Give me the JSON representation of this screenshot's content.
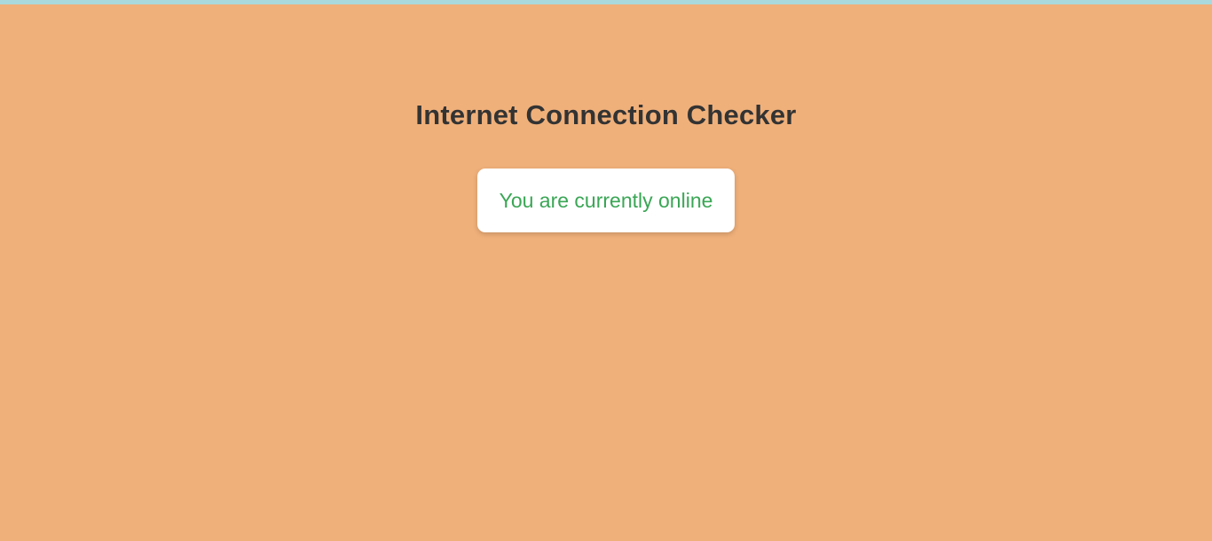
{
  "page": {
    "title": "Internet Connection Checker"
  },
  "status": {
    "message": "You are currently online",
    "state": "online",
    "color": "#3aa655"
  },
  "colors": {
    "background": "#f0b07a",
    "top_strip": "#a9d9dc",
    "title": "#333333",
    "card": "#ffffff"
  }
}
